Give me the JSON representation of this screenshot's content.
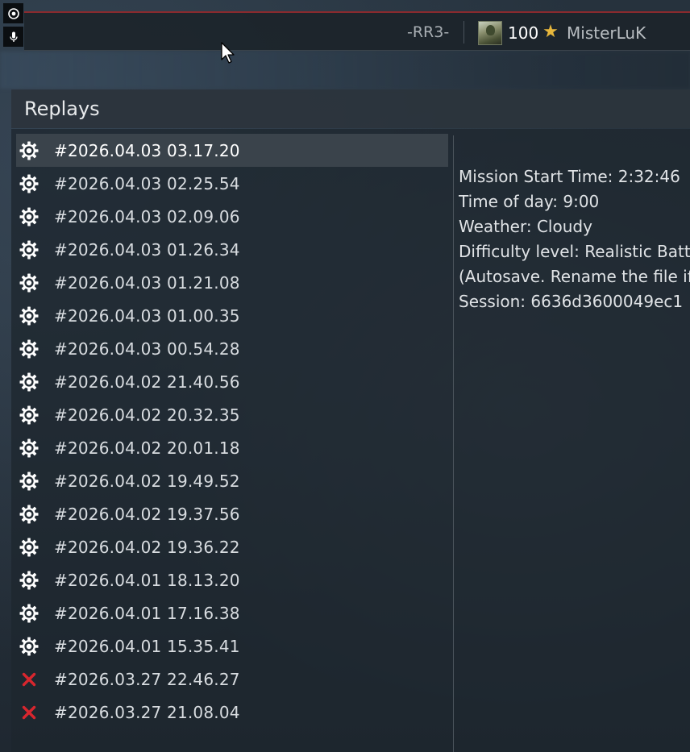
{
  "top_bar": {
    "clan_tag": "-RR3-",
    "player_level": "100",
    "username": "MisterLuK",
    "accent_color": "#8a2a2e"
  },
  "replays": {
    "title": "Replays",
    "items": [
      {
        "label": "#2026.04.03 03.17.20",
        "icon": "gear-icon",
        "selected": true
      },
      {
        "label": "#2026.04.03 02.25.54",
        "icon": "gear-icon"
      },
      {
        "label": "#2026.04.03 02.09.06",
        "icon": "gear-icon"
      },
      {
        "label": "#2026.04.03 01.26.34",
        "icon": "gear-icon"
      },
      {
        "label": "#2026.04.03 01.21.08",
        "icon": "gear-icon"
      },
      {
        "label": "#2026.04.03 01.00.35",
        "icon": "gear-icon"
      },
      {
        "label": "#2026.04.03 00.54.28",
        "icon": "gear-icon"
      },
      {
        "label": "#2026.04.02 21.40.56",
        "icon": "gear-icon"
      },
      {
        "label": "#2026.04.02 20.32.35",
        "icon": "gear-icon"
      },
      {
        "label": "#2026.04.02 20.01.18",
        "icon": "gear-icon"
      },
      {
        "label": "#2026.04.02 19.49.52",
        "icon": "gear-icon"
      },
      {
        "label": "#2026.04.02 19.37.56",
        "icon": "gear-icon"
      },
      {
        "label": "#2026.04.02 19.36.22",
        "icon": "gear-icon"
      },
      {
        "label": "#2026.04.01 18.13.20",
        "icon": "gear-icon"
      },
      {
        "label": "#2026.04.01 17.16.38",
        "icon": "gear-icon"
      },
      {
        "label": "#2026.04.01 15.35.41",
        "icon": "gear-icon"
      },
      {
        "label": "#2026.03.27 22.46.27",
        "icon": "invalid-x-icon"
      },
      {
        "label": "#2026.03.27 21.08.04",
        "icon": "invalid-x-icon"
      }
    ]
  },
  "details": {
    "mission_start_time": "Mission Start Time: 2:32:46",
    "time_of_day": "Time of day: 9:00",
    "weather": "Weather: Cloudy",
    "difficulty": "Difficulty level: Realistic Battles",
    "autosave_note": "(Autosave. Rename the file if you",
    "session": "Session: 6636d3600049ec1"
  }
}
